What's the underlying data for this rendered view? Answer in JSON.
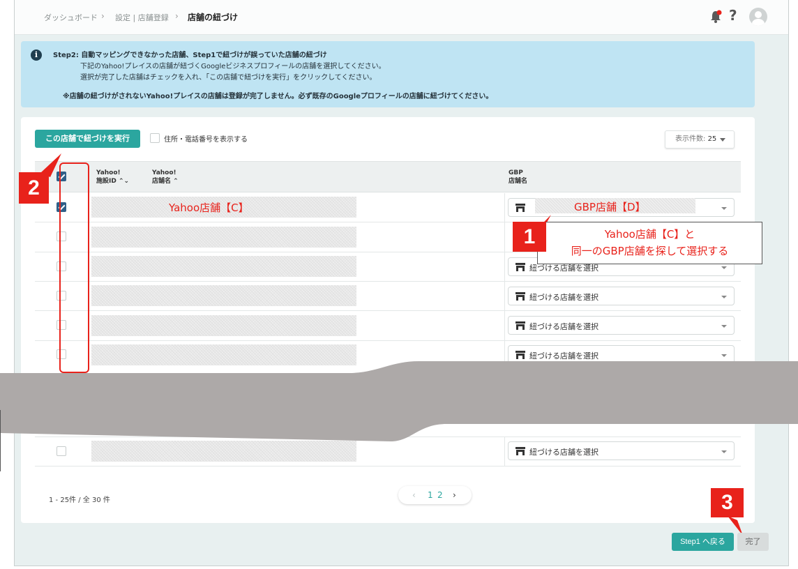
{
  "breadcrumb": {
    "items": [
      "ダッシュボード",
      "設定 | 店舗登録",
      "店舗の紐づけ"
    ],
    "separator": "›"
  },
  "header": {
    "help_label": "?"
  },
  "info": {
    "icon_label": "i",
    "title": "Step2: 自動マッピングできなかった店舗、Step1で紐づけが誤っていた店舗の紐づけ",
    "line1": "下記のYahoo!プレイスの店舗が紐づくGoogleビジネスプロフィールの店舗を選択してください。",
    "line2": "選択が完了した店舗はチェックを入れ、「この店舗で紐づけを実行」をクリックしてください。",
    "warning": "※店舗の紐づけがされないYahoo!プレイスの店舗は登録が完了しません。必ず既存のGoogleプロフィールの店舗に紐づけてください。"
  },
  "toolbar": {
    "exec_label": "この店舗で紐づけを実行",
    "show_address_label": "住所・電話番号を表示する",
    "per_page_label": "表示件数:",
    "per_page_value": "25"
  },
  "table": {
    "headers": {
      "yahoo_id": [
        "Yahoo!",
        "施設ID"
      ],
      "yahoo_name": [
        "Yahoo!",
        "店舗名"
      ],
      "gbp_name": [
        "GBP",
        "店舗名"
      ]
    },
    "sort_id_glyph": "⌃⌄",
    "sort_name_glyph": "⌃",
    "select_placeholder": "紐づける店舗を選択"
  },
  "annotations": {
    "yahoo_store": "Yahoo店舗【C】",
    "gbp_store": "GBP店舗【D】",
    "note_line1": "Yahoo店舗【C】と",
    "note_line2": "同一のGBP店舗を探して選択する",
    "badge1": "1",
    "badge2": "2",
    "badge3": "3"
  },
  "pagination": {
    "range": "1 - 25件 / 全 30 件",
    "prev": "‹",
    "pages": [
      "1",
      "2"
    ],
    "next": "›"
  },
  "footer": {
    "back_label": "Step1 へ戻る",
    "done_label": "完了"
  },
  "colors": {
    "accent": "#2ba69f",
    "annotation_red": "#e8221b",
    "info_bg": "#bfe4f3",
    "checkbox_checked": "#2f5f88"
  }
}
